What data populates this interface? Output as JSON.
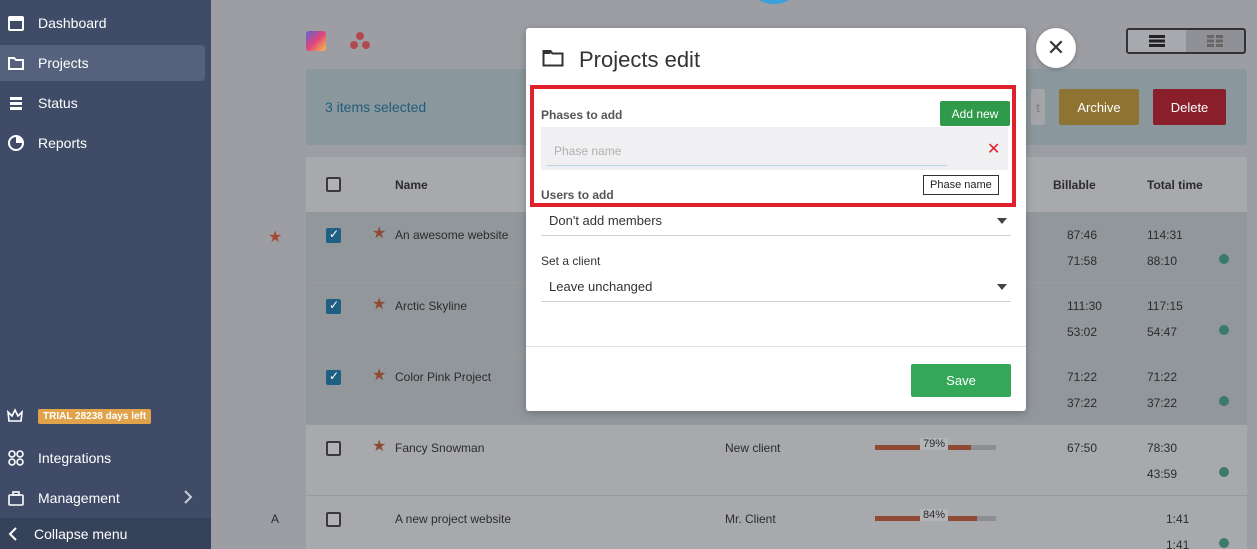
{
  "sidebar": {
    "items": [
      {
        "label": "Dashboard",
        "icon": "calendar-icon"
      },
      {
        "label": "Projects",
        "icon": "folder-icon",
        "active": true
      },
      {
        "label": "Status",
        "icon": "status-icon"
      },
      {
        "label": "Reports",
        "icon": "pie-chart-icon"
      }
    ],
    "trial_badge": "TRIAL 28238 days left",
    "bottom_items": [
      {
        "label": "Integrations",
        "icon": "integrations-icon"
      },
      {
        "label": "Management",
        "icon": "briefcase-icon"
      }
    ],
    "collapse_label": "Collapse menu"
  },
  "selection_bar": {
    "selected_text": "3 items selected",
    "edit_partial": "t",
    "archive_label": "Archive",
    "delete_label": "Delete"
  },
  "table": {
    "headers": {
      "name": "Name",
      "billable": "Billable",
      "total_time": "Total time"
    },
    "rows": [
      {
        "name": "An awesome website",
        "client": "",
        "billable": [
          "87:46",
          "71:58"
        ],
        "total": [
          "114:31",
          "88:10"
        ],
        "checked": true,
        "starred": true
      },
      {
        "name": "Arctic Skyline",
        "client": "",
        "billable": [
          "111:30",
          "53:02"
        ],
        "total": [
          "117:15",
          "54:47"
        ],
        "checked": true,
        "starred": true
      },
      {
        "name": "Color Pink Project",
        "client": "",
        "billable": [
          "71:22",
          "37:22"
        ],
        "total": [
          "71:22",
          "37:22"
        ],
        "checked": true,
        "starred": true
      },
      {
        "name": "Fancy Snowman",
        "client": "New client",
        "progress": 79,
        "progress_label": "79%",
        "billable": [
          "67:50",
          ""
        ],
        "total": [
          "78:30",
          "43:59"
        ],
        "checked": false,
        "starred": true
      },
      {
        "name": "A new project website",
        "client": "Mr. Client",
        "progress": 84,
        "progress_label": "84%",
        "billable": [
          "",
          ""
        ],
        "total": [
          "1:41",
          "1:41"
        ],
        "checked": false,
        "starred": false
      }
    ],
    "group_letter": "A"
  },
  "modal": {
    "title": "Projects edit",
    "phases_label": "Phases to add",
    "add_new_label": "Add new",
    "phase_placeholder": "Phase name",
    "phase_value": "",
    "tooltip": "Phase name",
    "users_label": "Users to add",
    "users_value": "Don't add members",
    "client_label": "Set a client",
    "client_value": "Leave unchanged",
    "save_label": "Save",
    "close_symbol": "✕"
  },
  "colors": {
    "sidebar_bg": "#3f4b67",
    "accent_green": "#34a858",
    "highlight_red": "#e0202b",
    "archive": "#d7a93f",
    "delete": "#d82a3f"
  }
}
